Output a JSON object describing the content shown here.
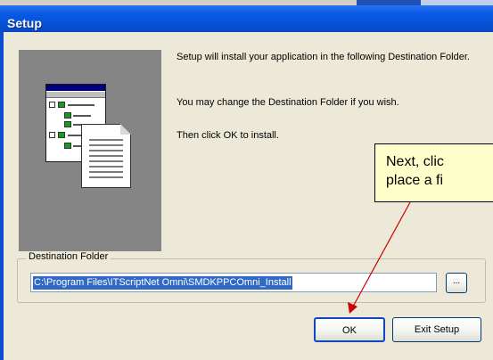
{
  "window": {
    "title": "Setup"
  },
  "messages": {
    "install_text": "Setup will install your application in the following Destination Folder.",
    "change_text": "You may change the Destination Folder if you wish.",
    "click_text": "Then click OK to install."
  },
  "destination": {
    "group_label": "Destination Folder",
    "path_value": "C:\\Program Files\\ITScriptNet Omni\\SMDKPPCOmni_Install",
    "browse_label": "..."
  },
  "buttons": {
    "ok_label": "OK",
    "exit_label": "Exit Setup"
  },
  "callout": {
    "line1": "Next, clic",
    "line2": "place a fi"
  },
  "colors": {
    "titlebar": "#0552d6",
    "callout_bg": "#ffffcc",
    "arrow": "#cc0000",
    "selection": "#316ac5"
  }
}
